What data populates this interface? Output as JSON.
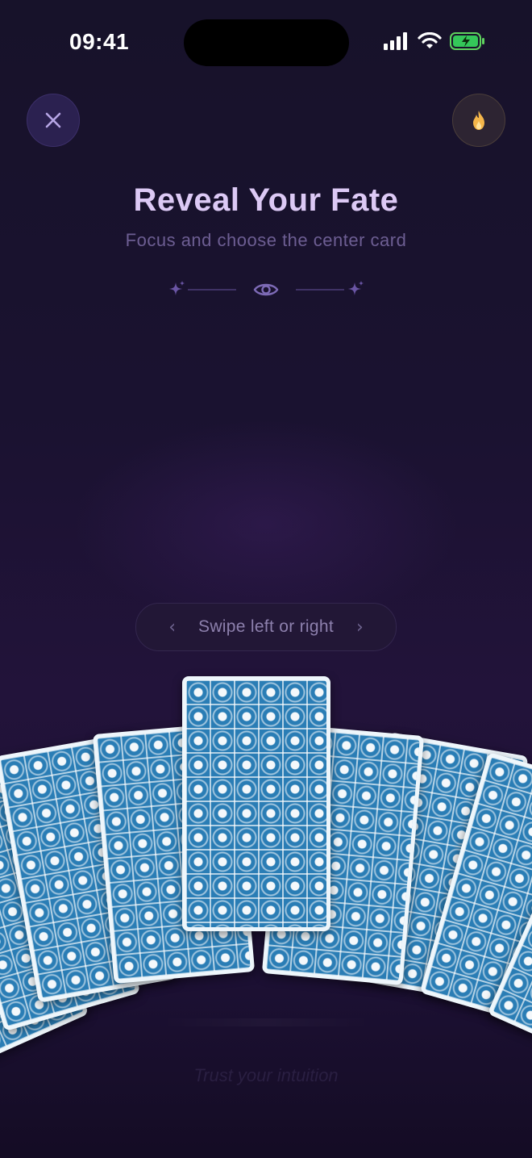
{
  "status_bar": {
    "time": "09:41"
  },
  "header": {
    "close_icon": "close-icon",
    "flame_icon": "flame-icon",
    "title": "Reveal Your Fate",
    "subtitle": "Focus and choose the center card"
  },
  "ornament": {
    "left_icon": "sparkle-icon",
    "center_icon": "eye-icon",
    "right_icon": "sparkle-icon"
  },
  "swipe": {
    "label": "Swipe left or right",
    "left_icon": "chevron-left-icon",
    "right_icon": "chevron-right-icon"
  },
  "cards": {
    "count": 9,
    "selected_index": 4
  },
  "footer": {
    "hint": "Trust your intuition"
  },
  "colors": {
    "accent": "#dcc9f5",
    "card_blue": "#2a7db5",
    "background": "#1a1230"
  }
}
